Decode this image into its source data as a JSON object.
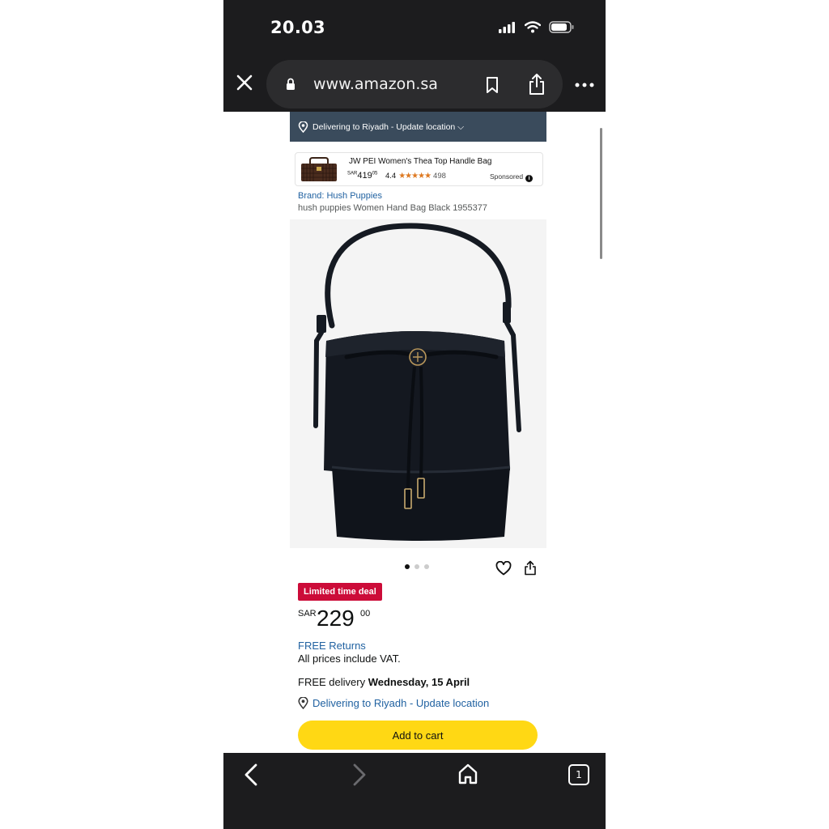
{
  "status_bar": {
    "time": "20.03"
  },
  "browser": {
    "url": "www.amazon.sa"
  },
  "delivery_bar": {
    "text": "Delivering to Riyadh - Update location ⌵"
  },
  "sponsored_ad": {
    "title": "JW PEI Women's Thea Top Handle Bag",
    "currency": "SAR",
    "price_whole": "419",
    "price_fraction": "05",
    "rating": "4.4",
    "stars": "★★★★★",
    "review_count": "498",
    "sponsored_label": "Sponsored",
    "info_symbol": "i"
  },
  "product": {
    "brand": "Brand: Hush Puppies",
    "title": "hush puppies Women Hand Bag Black 1955377",
    "image_count": 3,
    "active_image": 1,
    "deal_badge": "Limited time deal",
    "currency": "SAR",
    "price_whole": "229",
    "price_fraction": "00",
    "returns": "FREE Returns",
    "vat_note": "All prices include VAT.",
    "delivery_prefix": "FREE delivery ",
    "delivery_date": "Wednesday, 15 April",
    "delivery_location": "Delivering to Riyadh - Update location",
    "add_to_cart": "Add to cart"
  },
  "bottom_nav": {
    "tab_count": "1"
  },
  "colors": {
    "chrome": "#1c1c1e",
    "delivery_bar": "#3a4b5c",
    "link": "#2162a1",
    "deal": "#cc0c39",
    "cart_button": "#ffd814",
    "star": "#de7921"
  }
}
